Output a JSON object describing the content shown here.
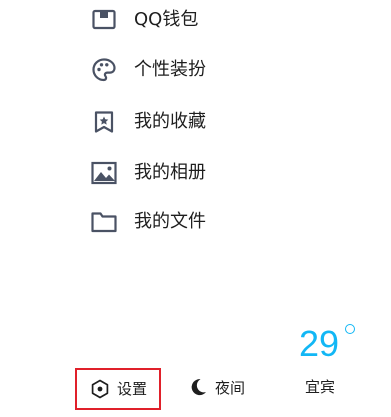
{
  "menu": {
    "items": [
      {
        "label": "QQ钱包",
        "icon": "wallet-icon"
      },
      {
        "label": "个性装扮",
        "icon": "palette-icon"
      },
      {
        "label": "我的收藏",
        "icon": "bookmark-star-icon"
      },
      {
        "label": "我的相册",
        "icon": "photo-album-icon"
      },
      {
        "label": "我的文件",
        "icon": "folder-icon"
      }
    ]
  },
  "bottom_bar": {
    "settings_label": "设置",
    "night_label": "夜间",
    "highlight_color": "#e0202a"
  },
  "weather": {
    "temperature": "29",
    "unit": "°",
    "condition": "宜宾",
    "accent_color": "#12b7f5"
  }
}
